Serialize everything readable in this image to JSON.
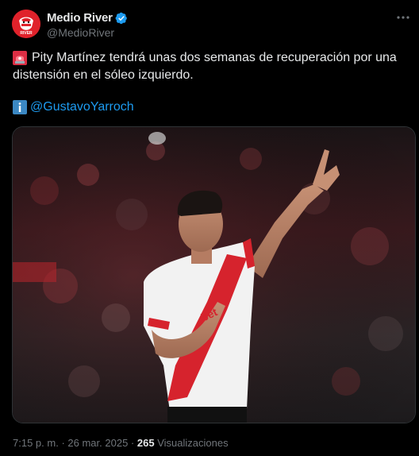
{
  "author": {
    "display_name": "Medio River",
    "handle": "@MedioRiver",
    "avatar_icon": "river-plate-logo-icon",
    "verified": true,
    "verified_color": "#1d9bf0"
  },
  "tweet": {
    "line1": "Pity Martínez tendrá unas dos semanas de recuperación por una",
    "line2": "distensión en el sóleo izquierdo.",
    "lead_emoji": "siren-icon",
    "info_emoji": "info-icon",
    "mention": "@GustavoYarroch"
  },
  "meta": {
    "time": "7:15 p. m.",
    "separator": "·",
    "date": "26 mar. 2025",
    "views_count": "265",
    "views_label": "Visualizaciones"
  },
  "colors": {
    "background": "#000000",
    "text": "#e7e9ea",
    "muted": "#71767b",
    "link": "#1d9bf0",
    "brand_red": "#e0222b"
  },
  "media": {
    "description_icon": "photo-player-celebrating"
  }
}
